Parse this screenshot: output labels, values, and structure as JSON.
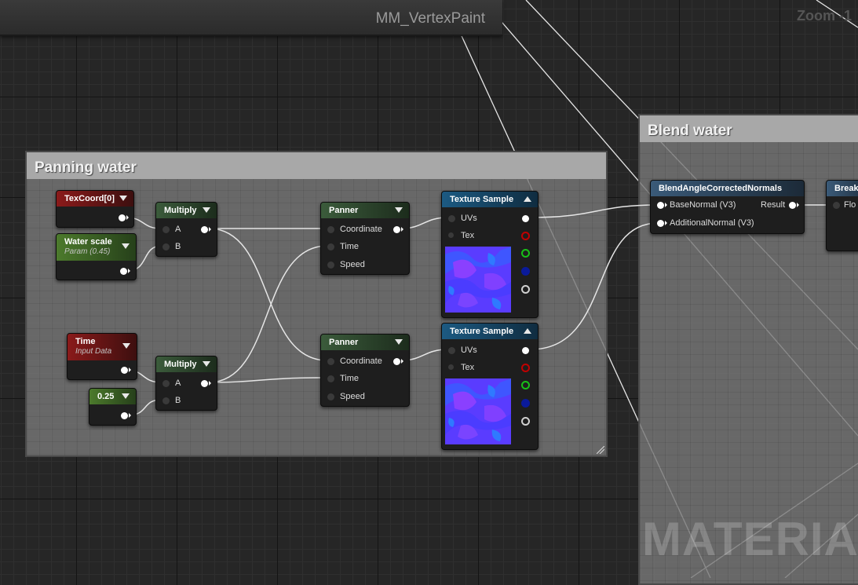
{
  "window": {
    "title": "MM_VertexPaint",
    "zoom_label": "Zoom -1"
  },
  "watermark": "MATERIAL",
  "comments": [
    {
      "id": "panning",
      "title": "Panning water"
    },
    {
      "id": "blend",
      "title": "Blend water"
    }
  ],
  "nodes": {
    "texcoord": {
      "title": "TexCoord[0]"
    },
    "water_scale": {
      "title": "Water scale",
      "subtitle": "Param (0.45)"
    },
    "multiply1": {
      "title": "Multiply",
      "pin_a": "A",
      "pin_b": "B"
    },
    "time": {
      "title": "Time",
      "subtitle": "Input Data"
    },
    "const025": {
      "title": "0.25"
    },
    "multiply2": {
      "title": "Multiply",
      "pin_a": "A",
      "pin_b": "B"
    },
    "panner1": {
      "title": "Panner",
      "pin_coordinate": "Coordinate",
      "pin_time": "Time",
      "pin_speed": "Speed"
    },
    "panner2": {
      "title": "Panner",
      "pin_coordinate": "Coordinate",
      "pin_time": "Time",
      "pin_speed": "Speed"
    },
    "texsample1": {
      "title": "Texture Sample",
      "pin_uvs": "UVs",
      "pin_tex": "Tex"
    },
    "texsample2": {
      "title": "Texture Sample",
      "pin_uvs": "UVs",
      "pin_tex": "Tex"
    },
    "blend_normals": {
      "title": "BlendAngleCorrectedNormals",
      "pin_base": "BaseNormal (V3)",
      "pin_additional": "AdditionalNormal (V3)",
      "pin_result": "Result"
    },
    "break": {
      "title": "Break",
      "pin_flo": "Flo"
    }
  },
  "colors": {
    "pin_red": "#c00000",
    "pin_green": "#18c018",
    "pin_blue": "#0a1a9a",
    "pin_white": "#d0d0d0",
    "wire": "#e6e6e6"
  }
}
